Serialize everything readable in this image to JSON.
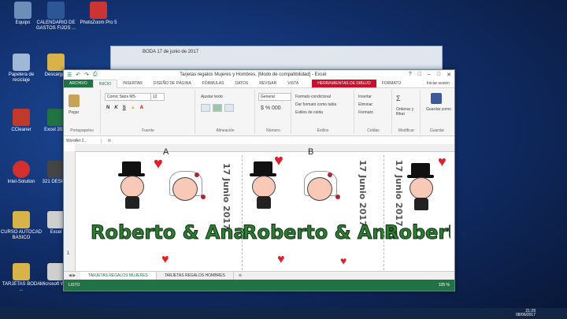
{
  "desktop": {
    "icons": [
      {
        "label": "Equipo",
        "color": "#6b8fb8"
      },
      {
        "label": "CALENDARIO DE GASTOS FIJOS ...",
        "color": "#2b5797"
      },
      {
        "label": "PhotoZoom Pro 5",
        "color": "#cc3333"
      },
      {
        "label": "Papelera de reciclaje",
        "color": "#9fb8d8"
      },
      {
        "label": "Descargas",
        "color": "#d8b34a"
      },
      {
        "label": "CCleaner",
        "color": "#c0392b"
      },
      {
        "label": "Excel 2013",
        "color": "#217346"
      },
      {
        "label": "Intel-Solution",
        "color": "#d32f2f"
      },
      {
        "label": "321 DESIGN",
        "color": "#444"
      },
      {
        "label": "CURSO AUTOCAD BASICO",
        "color": "#d8b34a"
      },
      {
        "label": "Excel",
        "color": "#cfcfcf"
      },
      {
        "label": "TARJETAS BODA ...",
        "color": "#d8b34a"
      },
      {
        "label": "Microsoft Word",
        "color": "#cfcfcf"
      }
    ]
  },
  "ghost_window": {
    "title": "BODA 17 de junio de 2017"
  },
  "excel": {
    "quick_access": [
      "☰",
      "↶",
      "↷",
      "⎙"
    ],
    "title": "Tarjetas regalos Mujeres y Hombres.  [Modo de compatibilidad] - Excel",
    "window_buttons": [
      "?",
      "□",
      "–",
      "□",
      "✕"
    ],
    "tabs": [
      "ARCHIVO",
      "INICIO",
      "INSERTAR",
      "DISEÑO DE PÁGINA",
      "FÓRMULAS",
      "DATOS",
      "REVISAR",
      "VISTA"
    ],
    "warning_tab": "HERRAMIENTAS DE DIBUJO",
    "format_tab": "FORMATO",
    "user": "Iniciar sesión",
    "ribbon": {
      "paste_label": "Pegar",
      "font_name": "Comic Sans MS",
      "font_size": "12",
      "bold": "N",
      "italic": "K",
      "underline": "S",
      "wrap": "Ajustar texto",
      "number_format": "General",
      "conditional": "Formato condicional",
      "table_format": "Dar formato como tabla",
      "cell_styles": "Estilos de celda",
      "insert": "Insertar",
      "delete": "Eliminar",
      "format": "Formato",
      "sort": "Ordenar y filtrar",
      "save_as": "Guardar como",
      "groups": [
        "Portapapeles",
        "Fuente",
        "Alineación",
        "Número",
        "Estilos",
        "Celdas",
        "Modificar",
        "Guardar"
      ]
    },
    "name_box": "WordArt 2...",
    "fx": "fx",
    "columns": [
      "A",
      "B"
    ],
    "row_label": "1",
    "cards": [
      {
        "names": "Roberto & Ana",
        "date": "17 Junio 2017"
      },
      {
        "names": "Roberto & Ana",
        "date": "17 Junio 2017"
      },
      {
        "names": "Robert",
        "date": "17 Junio 2017"
      }
    ],
    "sheet_tabs": [
      "TARJETAS REGALOS MUJERES",
      "TARJETAS REGALOS HOMBRES"
    ],
    "status": "LISTO",
    "zoom": "105 %"
  },
  "taskbar": {
    "time": "21:29",
    "date": "08/06/2017"
  }
}
